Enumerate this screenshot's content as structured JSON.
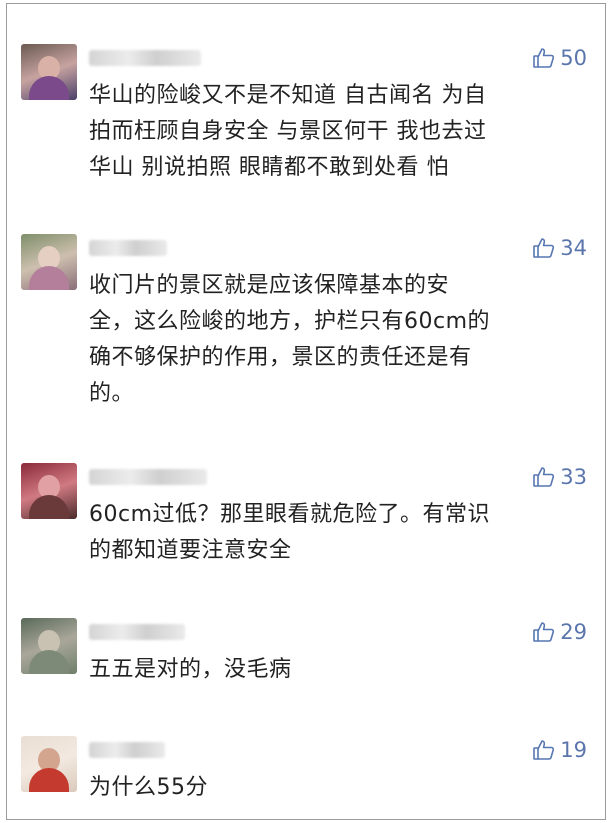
{
  "comments": [
    {
      "likes": "50",
      "lines": [
        "华山的险峻又不是不知道 自古闻名 为自",
        "拍而枉顾自身安全 与景区何干 我也去过",
        "华山 别说拍照 眼睛都不敢到处看 怕"
      ]
    },
    {
      "likes": "34",
      "lines": [
        "收门片的景区就是应该保障基本的安",
        "全，这么险峻的地方，护栏只有60cm的",
        "确不够保护的作用，景区的责任还是有",
        "的。"
      ]
    },
    {
      "likes": "33",
      "lines": [
        "60cm过低？那里眼看就危险了。有常识",
        "的都知道要注意安全"
      ]
    },
    {
      "likes": "29",
      "lines": [
        "五五是对的，没毛病"
      ]
    },
    {
      "likes": "19",
      "lines": [
        "为什么55分"
      ]
    }
  ],
  "icons": {
    "like": "thumbs-up-icon"
  },
  "colors": {
    "like_accent": "#5777b3",
    "text": "#222222",
    "border": "#9b9b9b"
  }
}
